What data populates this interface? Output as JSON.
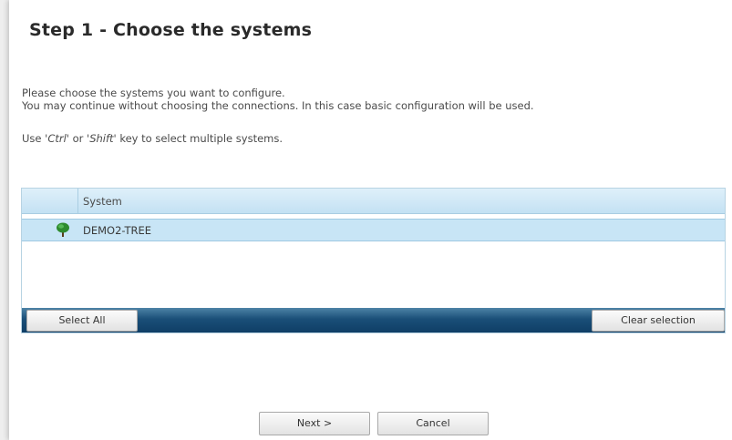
{
  "title": "Step 1 - Choose the systems",
  "instructions": {
    "line1": "Please choose the systems you want to configure.",
    "line2": "You may continue without choosing the connections. In this case basic configuration will be used.",
    "hint_prefix": "Use '",
    "hint_key1": "Ctrl",
    "hint_mid": "' or '",
    "hint_key2": "Shift",
    "hint_suffix": "' key to select multiple systems."
  },
  "grid": {
    "column_header": "System",
    "rows": [
      {
        "label": "DEMO2-TREE",
        "icon": "tree-icon",
        "selected": true
      }
    ],
    "select_all_label": "Select All",
    "clear_selection_label": "Clear selection"
  },
  "buttons": {
    "next_label": "Next >",
    "cancel_label": "Cancel"
  },
  "colors": {
    "header_bg": "#c3e1f3",
    "selected_row_bg": "#c8e5f6",
    "footer_bar": "#1a4f78",
    "tree_icon": "#2e8b2e"
  }
}
